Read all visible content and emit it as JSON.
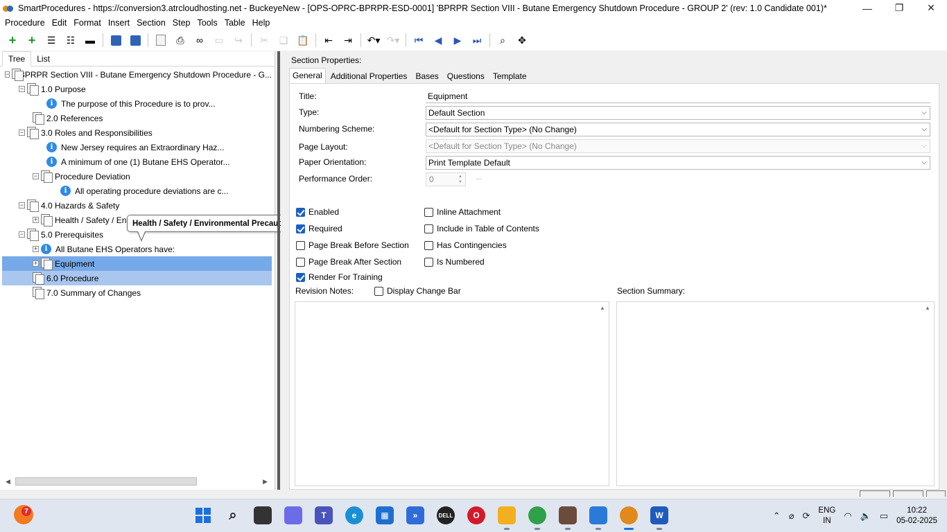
{
  "window": {
    "title": "SmartProcedures - https://conversion3.atrcloudhosting.net - BuckeyeNew - [OPS-OPRC-BPRPR-ESD-0001] 'BPRPR Section VIII - Butane Emergency Shutdown Procedure - GROUP 2' (rev: 1.0 Candidate 001)*",
    "minimize_glyph": "—",
    "restore_glyph": "❐",
    "close_glyph": "✕"
  },
  "menu": [
    "Procedure",
    "Edit",
    "Format",
    "Insert",
    "Section",
    "Step",
    "Tools",
    "Table",
    "Help"
  ],
  "left_tabs": [
    "Tree",
    "List"
  ],
  "tree": [
    {
      "label": "BPRPR Section VIII - Butane Emergency Shutdown Procedure - G...",
      "icon": "section-icon",
      "expander": "−"
    },
    {
      "label": "1.0 Purpose",
      "icon": "section-icon",
      "expander": "−"
    },
    {
      "label": "The purpose of this Procedure is to prov...",
      "icon": "info-icon",
      "expander": ""
    },
    {
      "label": "2.0 References",
      "icon": "section-icon",
      "expander": ""
    },
    {
      "label": "3.0 Roles and Responsibilities",
      "icon": "section-icon",
      "expander": "−"
    },
    {
      "label": "New Jersey requires an Extraordinary Haz...",
      "icon": "info-icon",
      "expander": ""
    },
    {
      "label": "A minimum of one (1) Butane EHS Operator...",
      "icon": "info-icon",
      "expander": ""
    },
    {
      "label": "Procedure Deviation",
      "icon": "section-icon",
      "expander": "−"
    },
    {
      "label": "All operating procedure deviations are c...",
      "icon": "info-icon",
      "expander": ""
    },
    {
      "label": "4.0 Hazards & Safety",
      "icon": "section-icon",
      "expander": "−"
    },
    {
      "label": "Health / Safety / En",
      "icon": "section-icon",
      "expander": "+"
    },
    {
      "label": "5.0 Prerequisites",
      "icon": "section-icon",
      "expander": "−"
    },
    {
      "label": "All Butane EHS Operators have:",
      "icon": "info-icon",
      "expander": "+"
    },
    {
      "label": "Equipment",
      "icon": "section-icon",
      "expander": "+"
    },
    {
      "label": "6.0 Procedure",
      "icon": "section-icon",
      "expander": ""
    },
    {
      "label": "7.0 Summary of Changes",
      "icon": "section-icon",
      "expander": ""
    }
  ],
  "tooltip": "Health / Safety / Environmental Precautions",
  "section_properties": {
    "heading": "Section Properties:",
    "tabs": [
      "General",
      "Additional Properties",
      "Bases",
      "Questions",
      "Template"
    ],
    "labels": {
      "title": "Title:",
      "type": "Type:",
      "numbering": "Numbering Scheme:",
      "layout": "Page Layout:",
      "orientation": "Paper Orientation:",
      "performance": "Performance Order:",
      "revision_notes": "Revision Notes:",
      "section_summary": "Section Summary:"
    },
    "values": {
      "title": "Equipment",
      "type": "Default Section",
      "numbering": "<Default for Section Type> (No Change)",
      "layout": "<Default for Section Type> (No Change)",
      "orientation": "Print Template Default",
      "performance": "0",
      "ellipsis": "..."
    },
    "checkboxes": {
      "enabled": {
        "label": "Enabled",
        "checked": true
      },
      "required": {
        "label": "Required",
        "checked": true
      },
      "page_break_before": {
        "label": "Page Break Before Section",
        "checked": false
      },
      "page_break_after": {
        "label": "Page Break After Section",
        "checked": false
      },
      "render_training": {
        "label": "Render For Training",
        "checked": true
      },
      "inline_attachment": {
        "label": "Inline Attachment",
        "checked": false
      },
      "include_toc": {
        "label": "Include in Table of Contents",
        "checked": false
      },
      "has_contingencies": {
        "label": "Has Contingencies",
        "checked": false
      },
      "is_numbered": {
        "label": "Is Numbered",
        "checked": false
      },
      "display_change_bar": {
        "label": "Display Change Bar",
        "checked": false
      }
    }
  },
  "taskbar": {
    "badge": "7",
    "tray": {
      "lang": "ENG",
      "region": "IN",
      "time": "10:22",
      "date": "05-02-2025"
    },
    "apps": [
      {
        "name": "start-icon",
        "color": "#1d6fe0"
      },
      {
        "name": "search-icon",
        "color": "#dfe6ef"
      },
      {
        "name": "task-view-icon",
        "color": "#333"
      },
      {
        "name": "copilot-icon",
        "color": "#6c6be8"
      },
      {
        "name": "teams-icon",
        "color": "#4b53bc"
      },
      {
        "name": "edge-icon",
        "color": "#1a8fd6"
      },
      {
        "name": "store-icon",
        "color": "#1f6fd1"
      },
      {
        "name": "power-automate-icon",
        "color": "#2f6cd9"
      },
      {
        "name": "dell-icon",
        "color": "#222"
      },
      {
        "name": "opera-icon",
        "color": "#d21a2a"
      },
      {
        "name": "file-explorer-icon",
        "color": "#f2b01e"
      },
      {
        "name": "chrome-icon",
        "color": "#2ea14a"
      },
      {
        "name": "contacts-icon",
        "color": "#6b4b3b"
      },
      {
        "name": "remote-desktop-icon",
        "color": "#2a7ad8"
      },
      {
        "name": "smartprocedures-icon",
        "color": "#e08a1e"
      },
      {
        "name": "word-icon",
        "color": "#1e5bbd"
      }
    ]
  }
}
